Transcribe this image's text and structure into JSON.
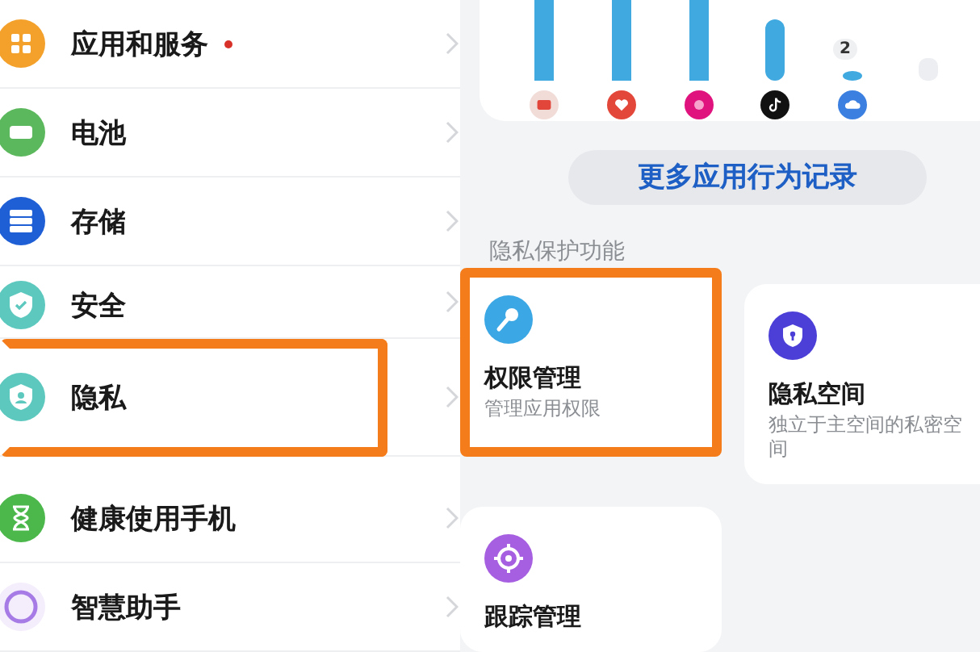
{
  "settings": {
    "items": [
      {
        "label": "应用和服务",
        "dot": true,
        "highlighted": false
      },
      {
        "label": "电池",
        "dot": false,
        "highlighted": false
      },
      {
        "label": "存储",
        "dot": false,
        "highlighted": false
      },
      {
        "label": "安全",
        "dot": false,
        "highlighted": false
      },
      {
        "label": "隐私",
        "dot": false,
        "highlighted": true
      },
      {
        "label": "健康使用手机",
        "dot": false,
        "highlighted": false
      },
      {
        "label": "智慧助手",
        "dot": false,
        "highlighted": false
      }
    ]
  },
  "usage": {
    "bar_label": "2"
  },
  "more_button": "更多应用行为记录",
  "section_title": "隐私保护功能",
  "features": [
    {
      "title": "权限管理",
      "subtitle": "管理应用权限",
      "highlighted": true
    },
    {
      "title": "隐私空间",
      "subtitle": "独立于主空间的私密空间",
      "highlighted": false
    },
    {
      "title": "跟踪管理",
      "highlighted": false
    }
  ]
}
